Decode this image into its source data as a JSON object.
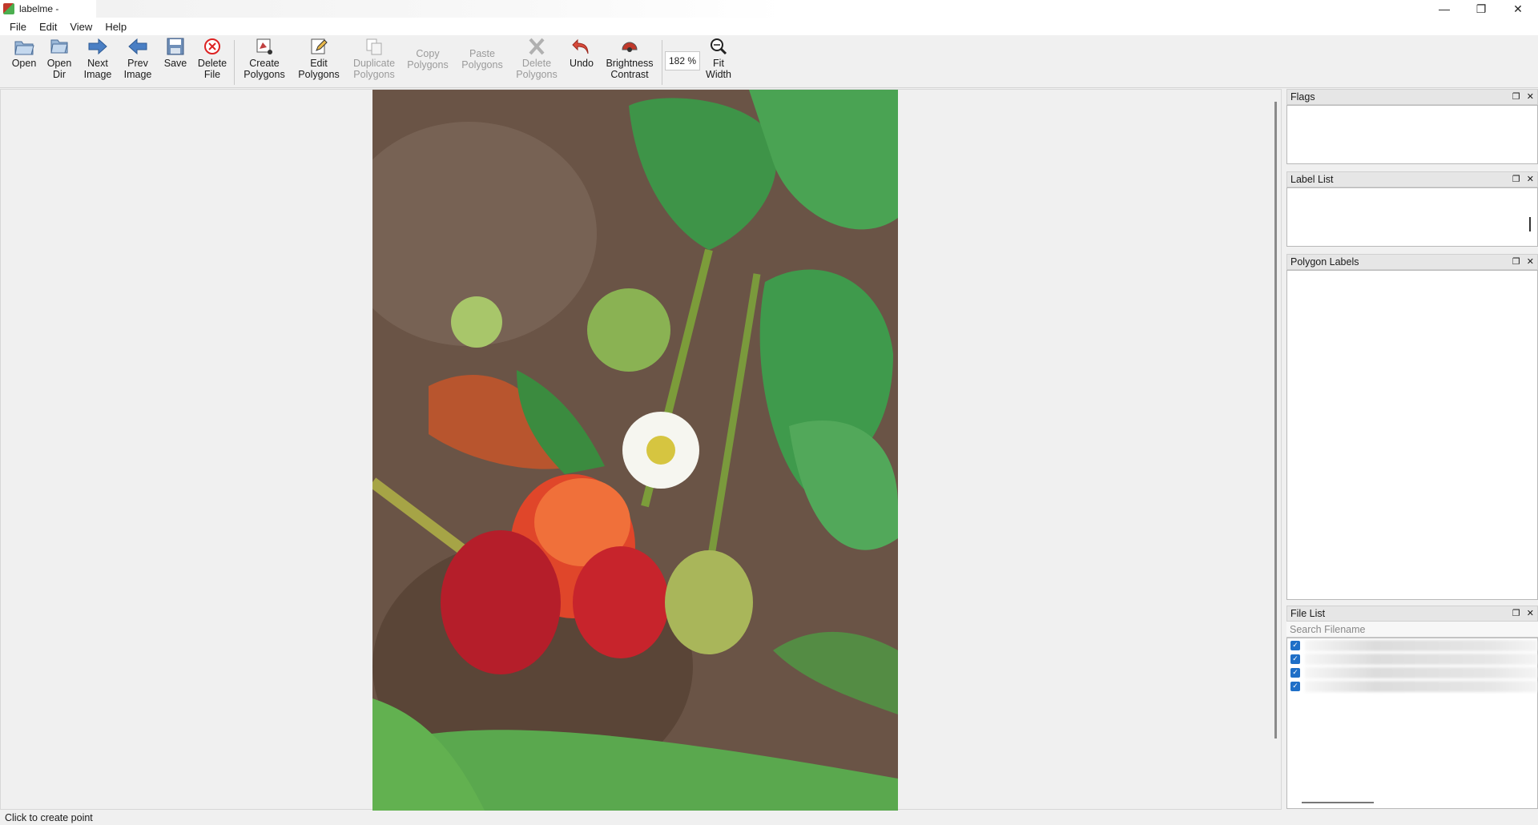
{
  "window": {
    "title": "labelme -"
  },
  "menu": [
    "File",
    "Edit",
    "View",
    "Help"
  ],
  "toolbar": {
    "open": "Open",
    "open_dir": "Open Dir",
    "next_image": "Next Image",
    "prev_image": "Prev Image",
    "save": "Save",
    "delete_file": "Delete File",
    "create_polygons": "Create Polygons",
    "edit_polygons": "Edit Polygons",
    "duplicate_polygons": "Duplicate Polygons",
    "copy_polygons": "Copy Polygons",
    "paste_polygons": "Paste Polygons",
    "delete_polygons": "Delete Polygons",
    "undo": "Undo",
    "brightness_contrast": "Brightness Contrast",
    "zoom": "182 %",
    "fit_width": "Fit Width"
  },
  "docks": {
    "flags": "Flags",
    "label_list": "Label List",
    "polygon_labels": "Polygon Labels",
    "file_list": "File List"
  },
  "file_list": {
    "search_placeholder": "Search Filename",
    "checked": [
      true,
      true,
      true,
      true
    ]
  },
  "status": "Click to create point"
}
